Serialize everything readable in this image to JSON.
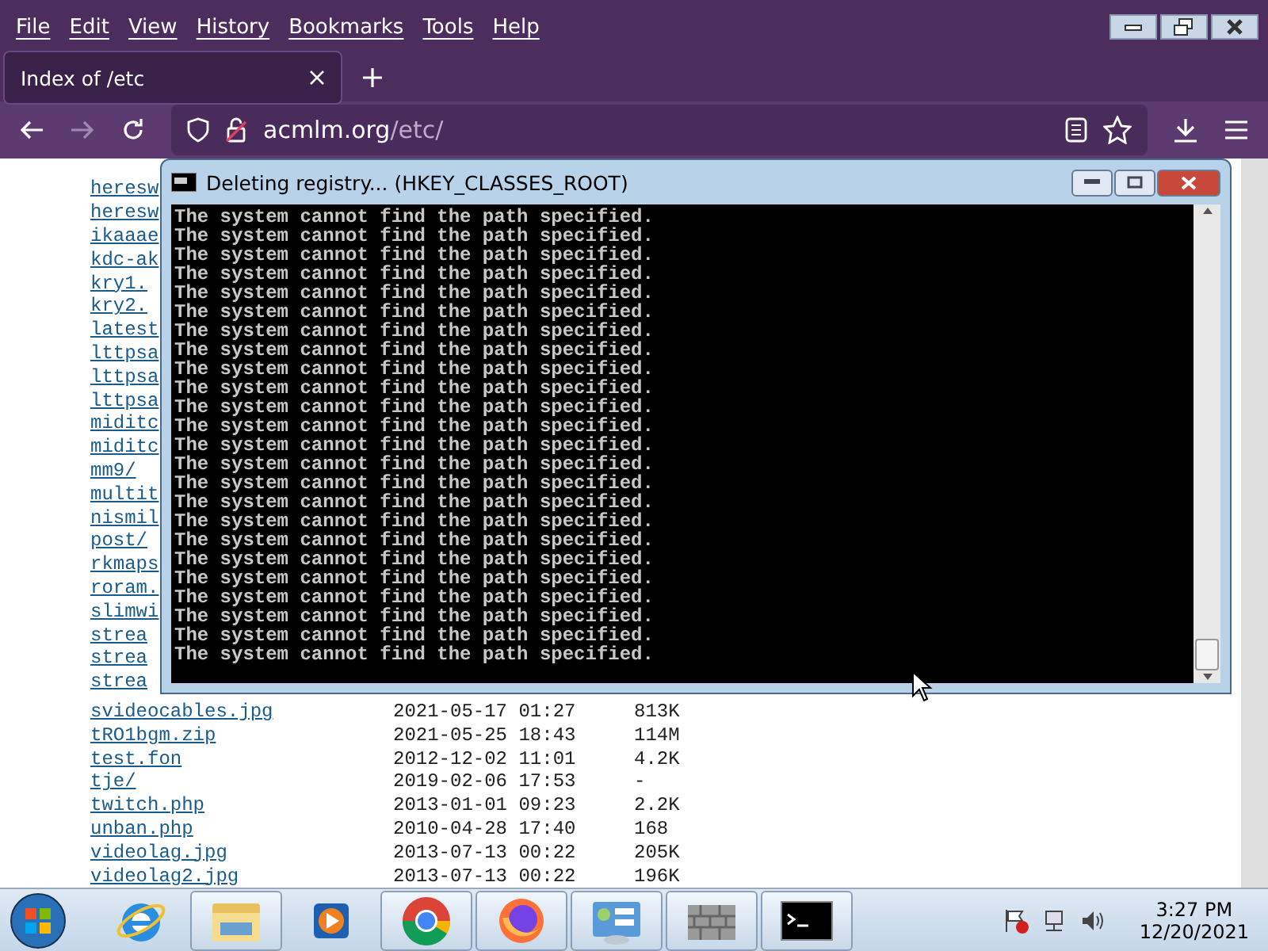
{
  "menu": [
    "File",
    "Edit",
    "View",
    "History",
    "Bookmarks",
    "Tools",
    "Help"
  ],
  "tabs": [
    {
      "title": "Index of /etc",
      "selected": true
    }
  ],
  "address": {
    "host": "acmlm.org",
    "path": "/etc/"
  },
  "listing": {
    "hidden_names": [
      "heresw",
      "heresw",
      "ikaaae",
      "kdc-ak",
      "kry1.",
      "kry2.",
      "latest",
      "lttpsa",
      "lttpsa",
      "lttpsa",
      "miditc",
      "miditc",
      "mm9/",
      "multit",
      "nismil",
      "post/",
      "rkmaps",
      "roram.",
      "slimwi",
      "strea",
      "strea",
      "strea"
    ],
    "rows": [
      {
        "name": "svideocables.jpg",
        "date": "2021-05-17 01:27",
        "size": "813K"
      },
      {
        "name": "tRO1bgm.zip",
        "date": "2021-05-25 18:43",
        "size": "114M"
      },
      {
        "name": "test.fon",
        "date": "2012-12-02 11:01",
        "size": "4.2K"
      },
      {
        "name": "tje/",
        "date": "2019-02-06 17:53",
        "size": "-"
      },
      {
        "name": "twitch.php",
        "date": "2013-01-01 09:23",
        "size": "2.2K"
      },
      {
        "name": "unban.php",
        "date": "2010-04-28 17:40",
        "size": "168"
      },
      {
        "name": "videolag.jpg",
        "date": "2013-07-13 00:22",
        "size": "205K"
      },
      {
        "name": "videolag2.jpg",
        "date": "2013-07-13 00:22",
        "size": "196K"
      }
    ]
  },
  "console": {
    "title": "Deleting registry... (HKEY_CLASSES_ROOT)",
    "lines": [
      "The system cannot find the path specified.",
      "The system cannot find the path specified.",
      "The system cannot find the path specified.",
      "The system cannot find the path specified.",
      "The system cannot find the path specified.",
      "The system cannot find the path specified.",
      "The system cannot find the path specified.",
      "The system cannot find the path specified.",
      "The system cannot find the path specified.",
      "The system cannot find the path specified.",
      "The system cannot find the path specified.",
      "The system cannot find the path specified.",
      "The system cannot find the path specified.",
      "The system cannot find the path specified.",
      "The system cannot find the path specified.",
      "The system cannot find the path specified.",
      "The system cannot find the path specified.",
      "The system cannot find the path specified.",
      "The system cannot find the path specified.",
      "The system cannot find the path specified.",
      "The system cannot find the path specified.",
      "The system cannot find the path specified.",
      "The system cannot find the path specified.",
      "The system cannot find the path specified."
    ]
  },
  "taskbar": [
    {
      "kind": "ie",
      "running": false
    },
    {
      "kind": "explorer",
      "running": true
    },
    {
      "kind": "media",
      "running": false
    },
    {
      "kind": "chrome",
      "running": true
    },
    {
      "kind": "firefox",
      "running": true
    },
    {
      "kind": "control",
      "running": true
    },
    {
      "kind": "firewall",
      "running": true
    },
    {
      "kind": "cmd",
      "running": true
    }
  ],
  "clock": {
    "time": "3:27 PM",
    "date": "12/20/2021"
  }
}
